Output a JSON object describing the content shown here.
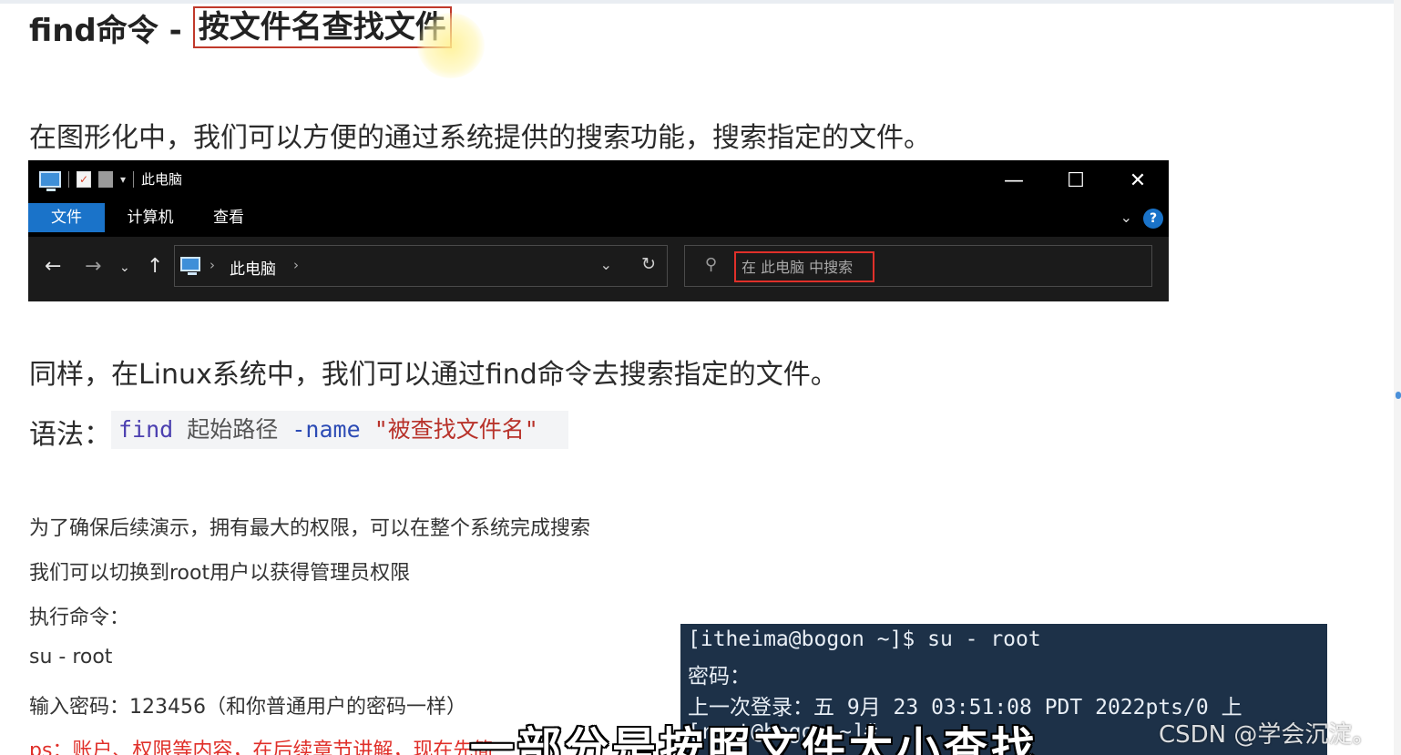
{
  "heading": {
    "prefix": "find命令 - ",
    "boxed": "按文件名查找文件"
  },
  "intro_gui": "在图形化中，我们可以方便的通过系统提供的搜索功能，搜索指定的文件。",
  "explorer": {
    "title": "此电脑",
    "ribbon_tabs": [
      "文件",
      "计算机",
      "查看"
    ],
    "address_path": "此电脑",
    "search_placeholder": "在 此电脑 中搜索",
    "accent": "#1a73c9",
    "highlight_color": "#e0302a"
  },
  "intro_linux": "同样，在Linux系统中，我们可以通过find命令去搜索指定的文件。",
  "syntax": {
    "label": "语法：",
    "cmd": "find",
    "path": "起始路径",
    "option": "-name",
    "pattern": "\"被查找文件名\""
  },
  "notes": [
    "为了确保后续演示，拥有最大的权限，可以在整个系统完成搜索",
    "我们可以切换到root用户以获得管理员权限",
    "执行命令：",
    "su - root",
    "输入密码：123456（和你普通用户的密码一样）",
    "ps：账户、权限等内容，在后续章节讲解，现在先简"
  ],
  "terminal": {
    "lines": [
      "[itheima@bogon ~]$ su - root",
      "密码：",
      "上一次登录：五 9月 23 03:51:08 PDT 2022pts/0 上",
      "[root@bogon ~]#"
    ]
  },
  "video_subtitle": "一部分是按照文件大小查找",
  "watermark": "CSDN @学会沉淀。"
}
